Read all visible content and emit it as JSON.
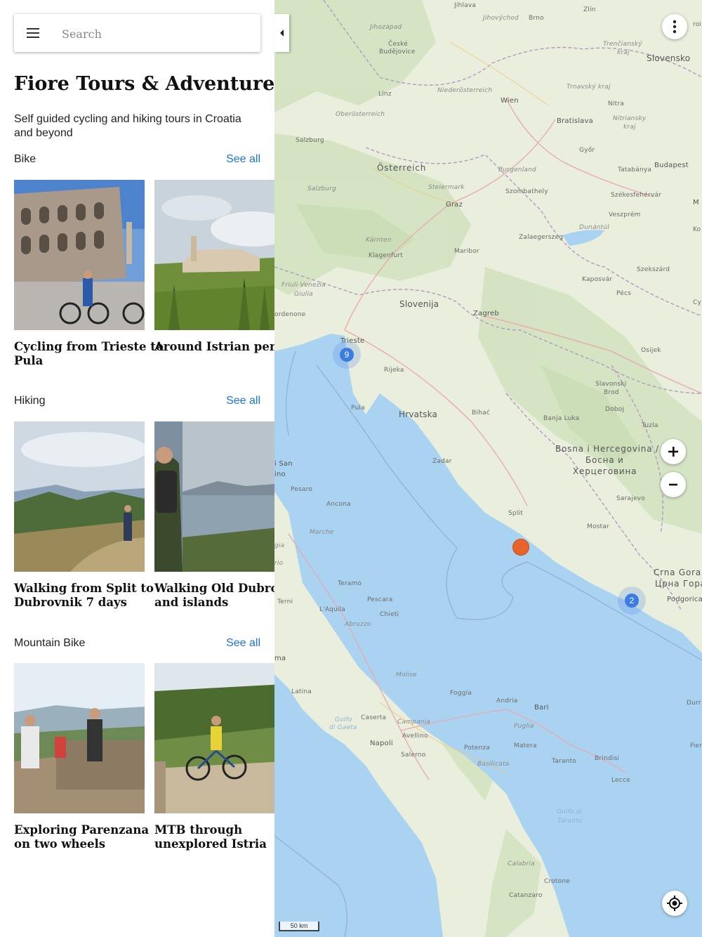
{
  "search": {
    "placeholder": "Search"
  },
  "header": {
    "title": "Fiore Tours & Adventure",
    "subtitle": "Self guided cycling and hiking tours in Croatia and beyond"
  },
  "sections": [
    {
      "name": "Bike",
      "see_all": "See all",
      "cards": [
        {
          "title_line1": "Cycling from Trieste to",
          "title_line2": "Pula"
        },
        {
          "title_line1": "Around Istrian peninsula",
          "title_line2": ""
        }
      ]
    },
    {
      "name": "Hiking",
      "see_all": "See all",
      "cards": [
        {
          "title_line1": "Walking from Split to",
          "title_line2": "Dubrovnik 7 days"
        },
        {
          "title_line1": "Walking Old Dubrovnik",
          "title_line2": "and islands"
        }
      ]
    },
    {
      "name": "Mountain Bike",
      "see_all": "See all",
      "cards": [
        {
          "title_line1": "Exploring Parenzana",
          "title_line2": "on two wheels"
        },
        {
          "title_line1": "MTB through",
          "title_line2": "unexplored Istria"
        }
      ]
    }
  ],
  "map": {
    "clusters": [
      {
        "count": "9"
      },
      {
        "count": "2"
      }
    ],
    "scale_label": "50 km",
    "labels": {
      "jihlava": "Jihlava",
      "zlin": "Zlín",
      "brno": "Brno",
      "jihovychod": "Jihovýchod",
      "jihozapad": "Jihozápad",
      "ceske": "České",
      "budejovice": "Budějovice",
      "trencin": "Trenčianský",
      "trencin2": "kraj",
      "slovensko": "Slovensko",
      "linz": "Linz",
      "niederosterreich": "Niederösterreich",
      "trnava": "Trnavský kraj",
      "wien": "Wien",
      "nitra": "Nitra",
      "oberosterreich": "Oberösterreich",
      "bratislava": "Bratislava",
      "nitriansky": "Nitriansky",
      "nitriansky2": "kraj",
      "salzburg": "Salzburg",
      "gyor": "Győr",
      "osterreich": "Österreich",
      "burgenland": "Burgenland",
      "tatabanya": "Tatabánya",
      "budapest": "Budapest",
      "steiermark": "Steiermark",
      "salzburg2": "Salzburg",
      "szombathely": "Szombathely",
      "szekesfehervar": "Székesfehérvár",
      "graz": "Graz",
      "veszprem": "Veszprém",
      "dunantul": "Dunántúl",
      "zalaegerszeg": "Zalaegerszeg",
      "karnten": "Kärnten",
      "klagenfurt": "Klagenfurt",
      "maribor": "Maribor",
      "szekszard": "Szekszárd",
      "kaposvar": "Kaposvár",
      "friuli": "Friuli-Venezia",
      "giulia": "Giulia",
      "pecs": "Pécs",
      "slovenija": "Slovenija",
      "zagreb": "Zagreb",
      "ordenone": "ordenone",
      "trieste": "Trieste",
      "osijek": "Osijek",
      "rijeka": "Rijeka",
      "slavonski": "Slavonski",
      "brod": "Brod",
      "doboj": "Doboj",
      "pula": "Pula",
      "hrvatska": "Hrvatska",
      "bihac": "Bihać",
      "banjaluka": "Banja Luka",
      "tuzla": "Tuzla",
      "bosna1": "Bosna i Hercegovina /",
      "bosna2": "Босна и",
      "bosna3": "Херцеговина",
      "isan": "i San",
      "ino": "ino",
      "zadar": "Zadar",
      "pesaro": "Pesaro",
      "sarajevo": "Sarajevo",
      "ancona": "Ancona",
      "split": "Split",
      "mostar": "Mostar",
      "marche": "Marche",
      "crnagora": "Crna Gora /",
      "crnagora2": "Црна Гора",
      "teramo": "Teramo",
      "podgorica": "Podgorica",
      "pescara": "Pescara",
      "terni": "Terni",
      "laquila": "L'Aquila",
      "chieti": "Chieti",
      "abruzzo": "Abruzzo",
      "ma": "ma",
      "molise": "Molise",
      "latina": "Latina",
      "foggia": "Foggia",
      "andria": "Andria",
      "bari": "Bari",
      "caserta": "Caserta",
      "campania": "Campania",
      "golfo": "Golfo",
      "digaeta": "di Gaeta",
      "avellino": "Avellino",
      "puglia": "Puglia",
      "napoli": "Napoli",
      "matera": "Matera",
      "potenza": "Potenza",
      "salerno": "Salerno",
      "taranto": "Taranto",
      "brindisi": "Brindisi",
      "basilicata": "Basilicata",
      "lecce": "Lecce",
      "golfodi": "Golfo di",
      "taranto2": "Taranto",
      "calabria": "Calabria",
      "crotone": "Crotone",
      "catanzaro": "Catanzaro",
      "durr": "Durr",
      "fier": "Fier",
      "ko": "Ko",
      "m": "M",
      "roi": "roi",
      "gia": "gia",
      "ro": "rio",
      "cy": "Cy"
    }
  }
}
